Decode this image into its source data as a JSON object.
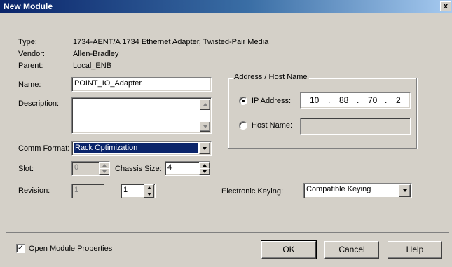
{
  "window": {
    "title": "New Module",
    "close_label": "x"
  },
  "info": {
    "type_label": "Type:",
    "type_value": "1734-AENT/A 1734 Ethernet Adapter, Twisted-Pair Media",
    "vendor_label": "Vendor:",
    "vendor_value": "Allen-Bradley",
    "parent_label": "Parent:",
    "parent_value": "Local_ENB"
  },
  "form": {
    "name_label": "Name:",
    "name_value": "POINT_IO_Adapter",
    "description_label": "Description:",
    "description_value": "",
    "comm_format_label": "Comm Format:",
    "comm_format_value": "Rack Optimization",
    "slot_label": "Slot:",
    "slot_value": "0",
    "chassis_size_label": "Chassis Size:",
    "chassis_size_value": "4",
    "revision_label": "Revision:",
    "revision_major": "1",
    "revision_minor": "1",
    "electronic_keying_label": "Electronic Keying:",
    "electronic_keying_value": "Compatible Keying"
  },
  "address": {
    "group_title": "Address / Host Name",
    "ip_label": "IP Address:",
    "ip_octets": [
      "10",
      "88",
      "70",
      "2"
    ],
    "ip_dot": ".",
    "ip_selected": true,
    "host_label": "Host Name:",
    "host_value": ""
  },
  "footer": {
    "open_props_label": "Open Module Properties",
    "open_props_checked": true,
    "check_mark": "✓",
    "ok_label": "OK",
    "cancel_label": "Cancel",
    "help_label": "Help"
  },
  "colors": {
    "title_start": "#0a246a",
    "title_end": "#a6caf0",
    "selection": "#0a246a",
    "face": "#d4d0c8"
  }
}
